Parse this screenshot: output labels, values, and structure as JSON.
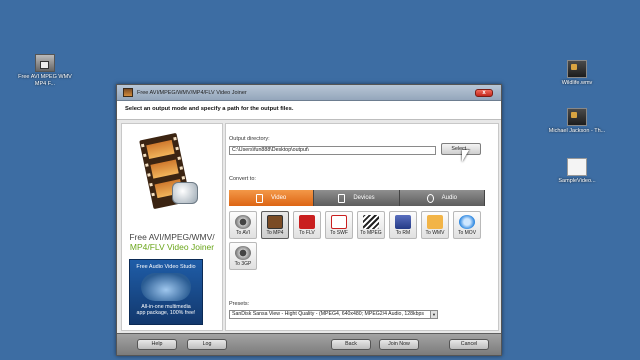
{
  "desktop": {
    "icons": [
      {
        "label": "Free AVI MPEG WMV MP4 F...",
        "icon": "app-shortcut-icon"
      },
      {
        "label": "Wildlife.wmv",
        "icon": "video-file-icon"
      },
      {
        "label": "Michael Jackson - Th...",
        "icon": "video-file-icon"
      },
      {
        "label": "SampleVideo...",
        "icon": "document-file-icon"
      }
    ]
  },
  "window": {
    "title": "Free AVI/MPEG/WMV/MP4/FLV Video Joiner",
    "close_label": "x",
    "header": "Select an output mode and specify a path for the output files."
  },
  "left_panel": {
    "product_line1": "Free AVI/MPEG/WMV/",
    "product_line2": "MP4/FLV Video Joiner",
    "promo_title": "Free Audio Video Studio",
    "promo_text1": "All-in-one multimedia",
    "promo_text2": "app package, 100% free!"
  },
  "output": {
    "label": "Output directory:",
    "value": "C:\\Users\\fun888\\Desktop\\output\\",
    "select_label": "Select..."
  },
  "convert": {
    "label": "Convert to:",
    "tabs": [
      {
        "label": "Video",
        "icon": "video-icon",
        "active": true
      },
      {
        "label": "Devices",
        "icon": "phone-icon",
        "active": false
      },
      {
        "label": "Audio",
        "icon": "music-note-icon",
        "active": false
      }
    ],
    "formats": [
      {
        "label": "To AVI",
        "icon": "film-reel-icon"
      },
      {
        "label": "To MP4",
        "icon": "film-strip-icon",
        "selected": true
      },
      {
        "label": "To FLV",
        "icon": "flash-icon"
      },
      {
        "label": "To SWF",
        "icon": "swf-icon"
      },
      {
        "label": "To MPEG",
        "icon": "clapperboard-icon"
      },
      {
        "label": "To RM",
        "icon": "realmedia-icon"
      },
      {
        "label": "To WMV",
        "icon": "windows-media-icon"
      },
      {
        "label": "To MOV",
        "icon": "quicktime-icon"
      },
      {
        "label": "To 3GP",
        "icon": "film-reel-icon"
      }
    ]
  },
  "presets": {
    "label": "Presets:",
    "value": "SanDisk Sansa View - Hight Quality - (MPEG4, 640x480; MPEG2/4 Audio, 128kbps"
  },
  "footer": {
    "help": "Help",
    "log": "Log",
    "back": "Back",
    "join_now": "Join Now",
    "cancel": "Cancel"
  },
  "colors": {
    "desktop": "#3d6da3",
    "accent_orange": "#f39848",
    "brand_green": "#6aa61a"
  }
}
